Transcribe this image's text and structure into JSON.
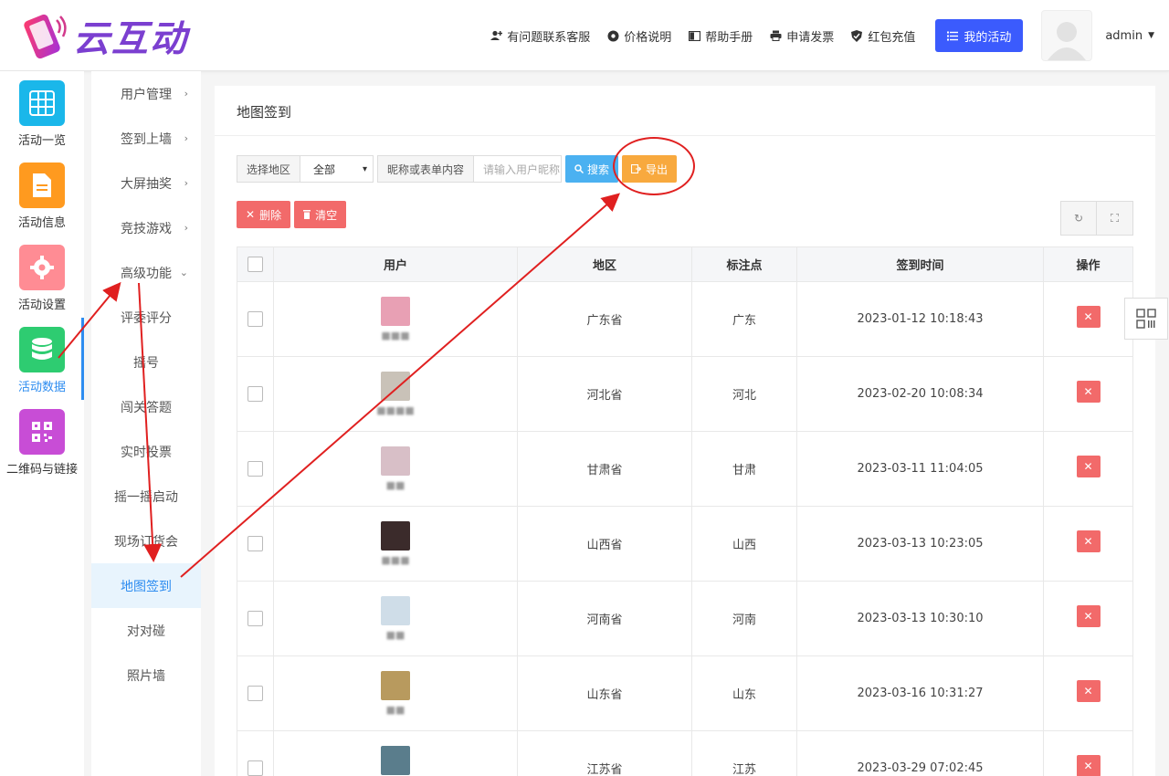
{
  "header": {
    "brand": "云互动",
    "links": [
      {
        "label": "有问题联系客服",
        "icon": "user-plus-icon"
      },
      {
        "label": "价格说明",
        "icon": "gear-icon"
      },
      {
        "label": "帮助手册",
        "icon": "book-icon"
      },
      {
        "label": "申请发票",
        "icon": "printer-icon"
      },
      {
        "label": "红包充值",
        "icon": "shield-check-icon"
      }
    ],
    "my_activity": "我的活动",
    "username": "admin"
  },
  "icon_sidebar": [
    {
      "label": "活动一览",
      "color": "#1ab7ea"
    },
    {
      "label": "活动信息",
      "color": "#ff9a1f"
    },
    {
      "label": "活动设置",
      "color": "#ff8c94"
    },
    {
      "label": "活动数据",
      "color": "#2ecc71"
    },
    {
      "label": "二维码与链接",
      "color": "#c84dd6"
    }
  ],
  "sub_menu": [
    {
      "label": "用户管理"
    },
    {
      "label": "签到上墙"
    },
    {
      "label": "大屏抽奖"
    },
    {
      "label": "竞技游戏"
    },
    {
      "label": "高级功能"
    },
    {
      "label": "评委评分"
    },
    {
      "label": "摇号"
    },
    {
      "label": "闯关答题"
    },
    {
      "label": "实时投票"
    },
    {
      "label": "摇一摇启动"
    },
    {
      "label": "现场订货会"
    },
    {
      "label": "地图签到"
    },
    {
      "label": "对对碰"
    },
    {
      "label": "照片墙"
    }
  ],
  "main": {
    "title": "地图签到",
    "region_label": "选择地区",
    "region_value": "全部",
    "keyword_label": "昵称或表单内容",
    "keyword_placeholder": "请输入用户昵称",
    "search_btn": "搜索",
    "export_btn": "导出",
    "delete_btn": "删除",
    "clear_btn": "清空",
    "columns": [
      "用户",
      "地区",
      "标注点",
      "签到时间",
      "操作"
    ],
    "rows": [
      {
        "name": "■■■",
        "region": "广东省",
        "mark": "广东",
        "time": "2023-01-12 10:18:43",
        "avatar": "#e8a0b4"
      },
      {
        "name": "■■■■",
        "region": "河北省",
        "mark": "河北",
        "time": "2023-02-20 10:08:34",
        "avatar": "#c9c2b8"
      },
      {
        "name": "■■",
        "region": "甘肃省",
        "mark": "甘肃",
        "time": "2023-03-11 11:04:05",
        "avatar": "#d8bfc7"
      },
      {
        "name": "■■■",
        "region": "山西省",
        "mark": "山西",
        "time": "2023-03-13 10:23:05",
        "avatar": "#3b2b2b"
      },
      {
        "name": "■■",
        "region": "河南省",
        "mark": "河南",
        "time": "2023-03-13 10:30:10",
        "avatar": "#cfdde8"
      },
      {
        "name": "■■",
        "region": "山东省",
        "mark": "山东",
        "time": "2023-03-16 10:31:27",
        "avatar": "#b89a5e"
      },
      {
        "name": "■■",
        "region": "江苏省",
        "mark": "江苏",
        "time": "2023-03-29 07:02:45",
        "avatar": "#5a7d8c"
      }
    ]
  }
}
